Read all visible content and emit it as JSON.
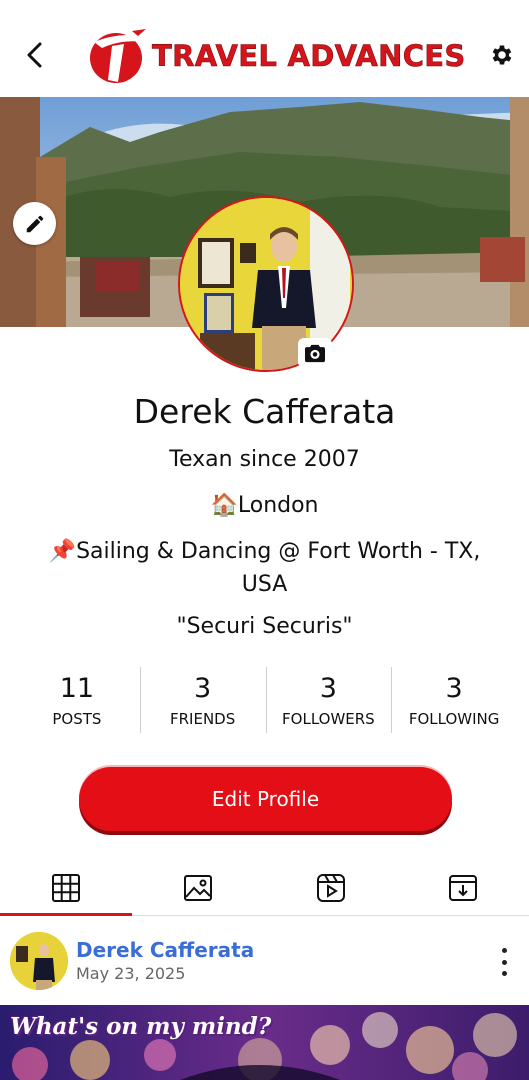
{
  "header": {
    "brand": "TRAVEL ADVANCES",
    "brand_color": "#d6141b"
  },
  "profile": {
    "name": "Derek Cafferata",
    "bio_line1": "Texan since 2007",
    "bio_location": "🏠London",
    "bio_activity": "📌Sailing & Dancing @ Fort Worth - TX, USA",
    "bio_quote": "\"Securi Securis\""
  },
  "stats": [
    {
      "value": "11",
      "label": "POSTS"
    },
    {
      "value": "3",
      "label": "FRIENDS"
    },
    {
      "value": "3",
      "label": "FOLLOWERS"
    },
    {
      "value": "3",
      "label": "FOLLOWING"
    }
  ],
  "edit_button": {
    "label": "Edit Profile",
    "color": "#e30e16"
  },
  "tabs": [
    {
      "icon": "grid-icon",
      "active": true
    },
    {
      "icon": "image-icon",
      "active": false
    },
    {
      "icon": "reels-icon",
      "active": false
    },
    {
      "icon": "archive-icon",
      "active": false
    }
  ],
  "post": {
    "author": "Derek Cafferata",
    "date": "May 23, 2025",
    "image_caption": "What's on my mind?"
  },
  "colors": {
    "accent": "#d6141b",
    "link": "#3a6ed6"
  }
}
